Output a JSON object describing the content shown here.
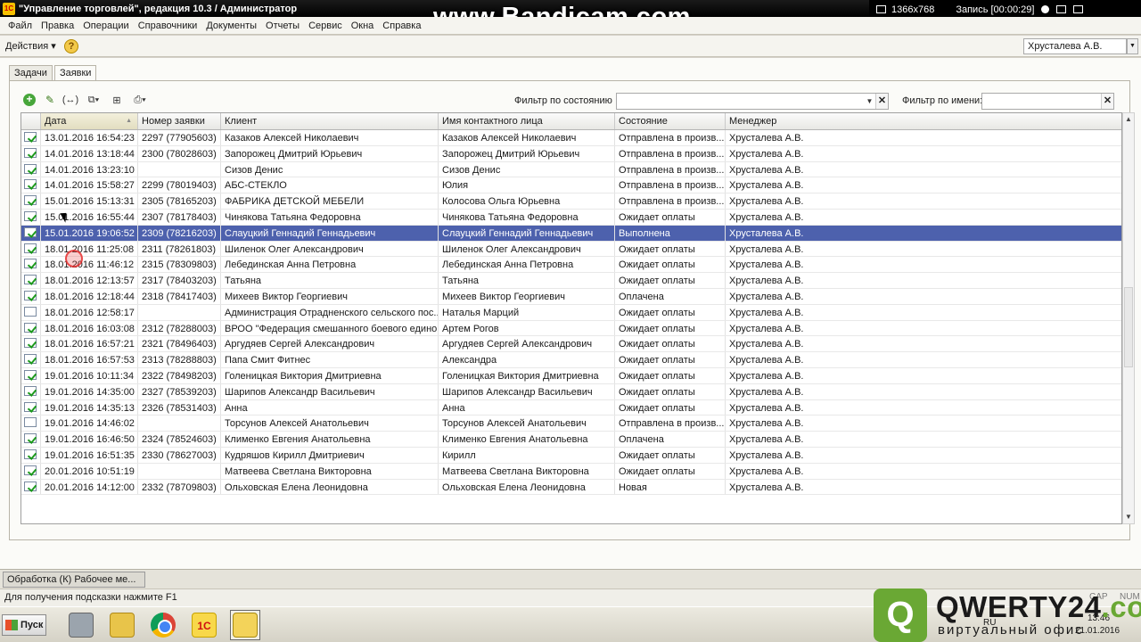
{
  "titlebar": {
    "title": "\"Управление торговлей\", редакция 10.3 / Администратор",
    "app_icon": "1C"
  },
  "watermark": "www.Bandicam.com",
  "recorder": {
    "resolution": "1366x768",
    "status": "Запись [00:00:29]"
  },
  "menu": [
    "Файл",
    "Правка",
    "Операции",
    "Справочники",
    "Документы",
    "Отчеты",
    "Сервис",
    "Окна",
    "Справка"
  ],
  "actions": {
    "label": "Действия ▾",
    "help": "?",
    "user": "Хрусталева А.В."
  },
  "tabs": [
    "Задачи",
    "Заявки"
  ],
  "filters": {
    "state_label": "Фильтр по состоянию",
    "state_value": "",
    "name_label": "Фильтр по имени:",
    "name_value": ""
  },
  "columns": [
    "Дата",
    "Номер заявки",
    "Клиент",
    "Имя контактного лица",
    "Состояние",
    "Менеджер"
  ],
  "rows": [
    {
      "done": true,
      "date": "13.01.2016 16:54:23",
      "num": "2297 (77905603)",
      "client": "Казаков Алексей Николаевич",
      "contact": "Казаков Алексей Николаевич",
      "state": "Отправлена в произв...",
      "manager": "Хрусталева А.В."
    },
    {
      "done": true,
      "date": "14.01.2016 13:18:44",
      "num": "2300 (78028603)",
      "client": "Запорожец Дмитрий Юрьевич",
      "contact": "Запорожец Дмитрий Юрьевич",
      "state": "Отправлена в произв...",
      "manager": "Хрусталева А.В."
    },
    {
      "done": true,
      "date": "14.01.2016 13:23:10",
      "num": "",
      "client": "Сизов Денис",
      "contact": "Сизов Денис",
      "state": "Отправлена в произв...",
      "manager": "Хрусталева А.В."
    },
    {
      "done": true,
      "date": "14.01.2016 15:58:27",
      "num": "2299 (78019403)",
      "client": "АБС-СТЕКЛО",
      "contact": "Юлия",
      "state": "Отправлена в произв...",
      "manager": "Хрусталева А.В."
    },
    {
      "done": true,
      "date": "15.01.2016 15:13:31",
      "num": "2305 (78165203)",
      "client": "ФАБРИКА ДЕТСКОЙ МЕБЕЛИ",
      "contact": "Колосова Ольга Юрьевна",
      "state": "Отправлена в произв...",
      "manager": "Хрусталева А.В."
    },
    {
      "done": true,
      "date": "15.01.2016 16:55:44",
      "num": "2307 (78178403)",
      "client": "Чинякова Татьяна Федоровна",
      "contact": "Чинякова Татьяна Федоровна",
      "state": "Ожидает оплаты",
      "manager": "Хрусталева А.В."
    },
    {
      "done": true,
      "selected": true,
      "date": "15.01.2016 19:06:52",
      "num": "2309 (78216203)",
      "client": "Слауцкий Геннадий Геннадьевич",
      "contact": "Слауцкий Геннадий Геннадьевич",
      "state": "Выполнена",
      "manager": "Хрусталева А.В."
    },
    {
      "done": true,
      "date": "18.01.2016 11:25:08",
      "num": "2311 (78261803)",
      "client": "Шиленок Олег Александрович",
      "contact": "Шиленок Олег Александрович",
      "state": "Ожидает оплаты",
      "manager": "Хрусталева А.В."
    },
    {
      "done": true,
      "date": "18.01.2016 11:46:12",
      "num": "2315 (78309803)",
      "client": "Лебединская Анна Петровна",
      "contact": "Лебединская Анна Петровна",
      "state": "Ожидает оплаты",
      "manager": "Хрусталева А.В."
    },
    {
      "done": true,
      "date": "18.01.2016 12:13:57",
      "num": "2317 (78403203)",
      "client": "Татьяна",
      "contact": "Татьяна",
      "state": "Ожидает оплаты",
      "manager": "Хрусталева А.В."
    },
    {
      "done": true,
      "date": "18.01.2016 12:18:44",
      "num": "2318 (78417403)",
      "client": "Михеев Виктор Георгиевич",
      "contact": "Михеев Виктор Георгиевич",
      "state": "Оплачена",
      "manager": "Хрусталева А.В."
    },
    {
      "done": false,
      "date": "18.01.2016 12:58:17",
      "num": "",
      "client": "Администрация Отрадненского сельского пос...",
      "contact": "Наталья Марций",
      "state": "Ожидает оплаты",
      "manager": "Хрусталева А.В."
    },
    {
      "done": true,
      "date": "18.01.2016 16:03:08",
      "num": "2312 (78288003)",
      "client": "ВРОО \"Федерация смешанного боевого едино...",
      "contact": "Артем Рогов",
      "state": "Ожидает оплаты",
      "manager": "Хрусталева А.В."
    },
    {
      "done": true,
      "date": "18.01.2016 16:57:21",
      "num": "2321 (78496403)",
      "client": "Аргудяев Сергей Александрович",
      "contact": "Аргудяев Сергей Александрович",
      "state": "Ожидает оплаты",
      "manager": "Хрусталева А.В."
    },
    {
      "done": true,
      "date": "18.01.2016 16:57:53",
      "num": "2313 (78288803)",
      "client": "Папа Смит Фитнес",
      "contact": "Александра",
      "state": "Ожидает оплаты",
      "manager": "Хрусталева А.В."
    },
    {
      "done": true,
      "date": "19.01.2016 10:11:34",
      "num": "2322 (78498203)",
      "client": "Голеницкая Виктория Дмитриевна",
      "contact": "Голеницкая Виктория Дмитриевна",
      "state": "Ожидает оплаты",
      "manager": "Хрусталева А.В."
    },
    {
      "done": true,
      "date": "19.01.2016 14:35:00",
      "num": "2327 (78539203)",
      "client": "Шарипов Александр Васильевич",
      "contact": "Шарипов Александр Васильевич",
      "state": "Ожидает оплаты",
      "manager": "Хрусталева А.В."
    },
    {
      "done": true,
      "date": "19.01.2016 14:35:13",
      "num": "2326 (78531403)",
      "client": "Анна",
      "contact": "Анна",
      "state": "Ожидает оплаты",
      "manager": "Хрусталева А.В."
    },
    {
      "done": false,
      "date": "19.01.2016 14:46:02",
      "num": "",
      "client": "Торсунов Алексей Анатольевич",
      "contact": "Торсунов Алексей Анатольевич",
      "state": "Отправлена в произв...",
      "manager": "Хрусталева А.В."
    },
    {
      "done": true,
      "date": "19.01.2016 16:46:50",
      "num": "2324 (78524603)",
      "client": "Клименко Евгения Анатольевна",
      "contact": "Клименко Евгения Анатольевна",
      "state": "Оплачена",
      "manager": "Хрусталева А.В."
    },
    {
      "done": true,
      "date": "19.01.2016 16:51:35",
      "num": "2330 (78627003)",
      "client": "Кудряшов Кирилл Дмитриевич",
      "contact": "Кирилл",
      "state": "Ожидает оплаты",
      "manager": "Хрусталева А.В."
    },
    {
      "done": true,
      "date": "20.01.2016 10:51:19",
      "num": "",
      "client": "Матвеева Светлана Викторовна",
      "contact": "Матвеева Светлана Викторовна",
      "state": "Ожидает оплаты",
      "manager": "Хрусталева А.В."
    },
    {
      "done": true,
      "date": "20.01.2016 14:12:00",
      "num": "2332 (78709803)",
      "client": "Ольховская Елена Леонидовна",
      "contact": "Ольховская Елена Леонидовна",
      "state": "Новая",
      "manager": "Хрусталева А.В."
    }
  ],
  "window_tab": "Обработка  (К) Рабочее ме...",
  "status": {
    "hint": "Для получения подсказки нажмите F1",
    "cap": "CAP",
    "num": "NUM"
  },
  "taskbar": {
    "start": "Пуск",
    "lang": "RU",
    "time": "13:46",
    "date": "21.01.2016"
  },
  "logo": {
    "name": "QWERTY24",
    "tld": ".com",
    "tagline": "виртуальный офис"
  },
  "colors": {
    "selection": "#4d61ad",
    "logo_green": "#6aa834"
  }
}
